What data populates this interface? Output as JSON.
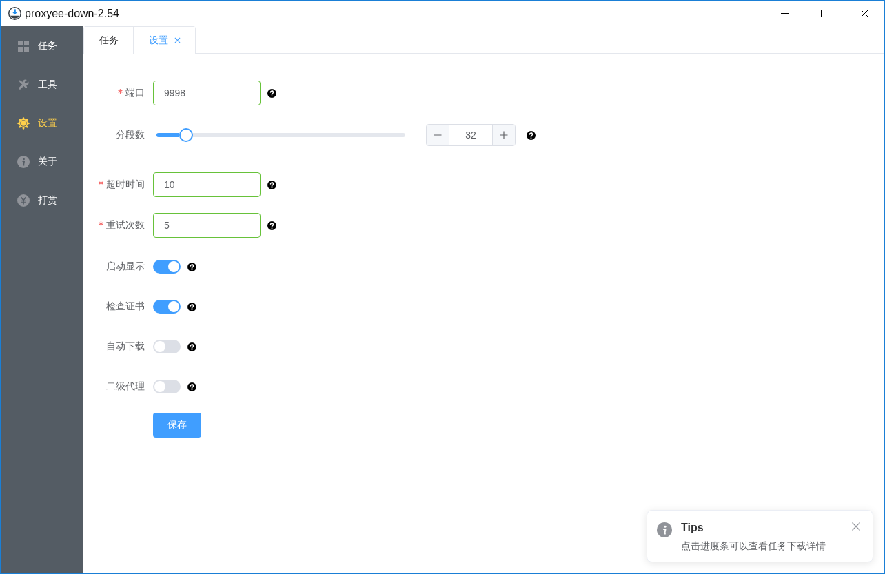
{
  "window": {
    "title": "proxyee-down-2.54"
  },
  "sidebar": {
    "items": [
      {
        "label": "任务",
        "selected": false
      },
      {
        "label": "工具",
        "selected": false
      },
      {
        "label": "设置",
        "selected": true
      },
      {
        "label": "关于",
        "selected": false
      },
      {
        "label": "打赏",
        "selected": false
      }
    ]
  },
  "tabs": [
    {
      "label": "任务",
      "selected": false,
      "closable": false
    },
    {
      "label": "设置",
      "selected": true,
      "closable": true
    }
  ],
  "form": {
    "fields": [
      {
        "kind": "text",
        "label": "端口",
        "required": true,
        "valid": true,
        "value": "9998"
      },
      {
        "kind": "slider",
        "label": "分段数",
        "required": false,
        "level": 0.12,
        "value": "32"
      },
      {
        "kind": "text",
        "label": "超时时间",
        "required": true,
        "valid": true,
        "value": "10"
      },
      {
        "kind": "text",
        "label": "重试次数",
        "required": true,
        "valid": true,
        "value": "5"
      },
      {
        "kind": "switch",
        "label": "启动显示",
        "required": false,
        "on": true
      },
      {
        "kind": "switch",
        "label": "检查证书",
        "required": false,
        "on": true
      },
      {
        "kind": "switch",
        "label": "自动下载",
        "required": false,
        "on": false
      },
      {
        "kind": "switch",
        "label": "二级代理",
        "required": false,
        "on": false
      }
    ],
    "submit": "保存"
  },
  "notification": {
    "title": "Tips",
    "message": "点击进度条可以查看任务下载详情"
  }
}
